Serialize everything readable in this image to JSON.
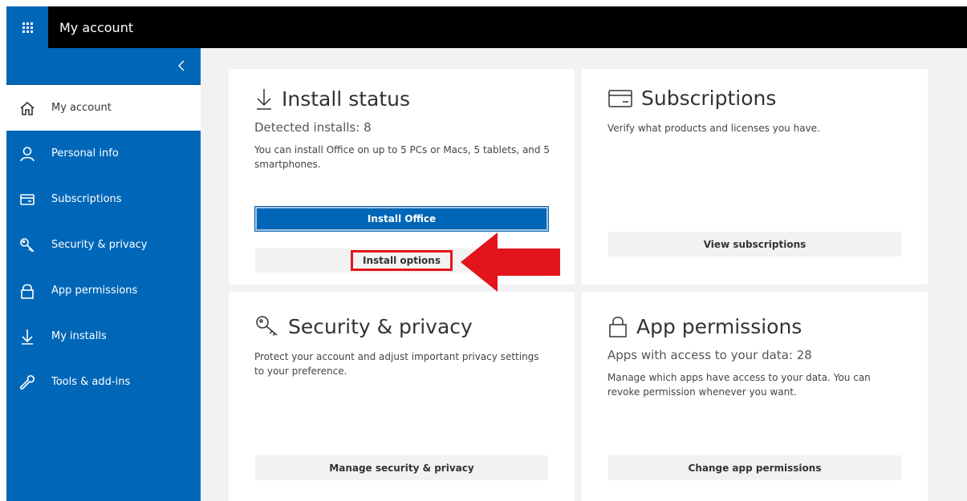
{
  "header": {
    "app_title": "My account"
  },
  "sidebar": {
    "items": [
      {
        "label": "My account",
        "icon": "home-icon"
      },
      {
        "label": "Personal info",
        "icon": "person-icon"
      },
      {
        "label": "Subscriptions",
        "icon": "card-icon"
      },
      {
        "label": "Security & privacy",
        "icon": "key-icon"
      },
      {
        "label": "App permissions",
        "icon": "lock-icon"
      },
      {
        "label": "My installs",
        "icon": "download-icon"
      },
      {
        "label": "Tools & add-ins",
        "icon": "wrench-icon"
      }
    ]
  },
  "install_status": {
    "title": "Install status",
    "detected": "Detected installs: 8",
    "description": "You can install Office on up to 5 PCs or Macs, 5 tablets, and 5 smartphones.",
    "primary_label": "Install Office",
    "secondary_label": "Install options"
  },
  "subscriptions": {
    "title": "Subscriptions",
    "description": "Verify what products and licenses you have.",
    "button_label": "View subscriptions"
  },
  "security": {
    "title": "Security & privacy",
    "description": "Protect your account and adjust important privacy settings to your preference.",
    "button_label": "Manage security & privacy"
  },
  "app_permissions": {
    "title": "App permissions",
    "subhead": "Apps with access to your data: 28",
    "description": "Manage which apps have access to your data. You can revoke permission whenever you want.",
    "button_label": "Change app permissions"
  },
  "colors": {
    "brand_blue": "#0067b8",
    "annotation_red": "#e3141b",
    "top_bar": "#000000"
  }
}
